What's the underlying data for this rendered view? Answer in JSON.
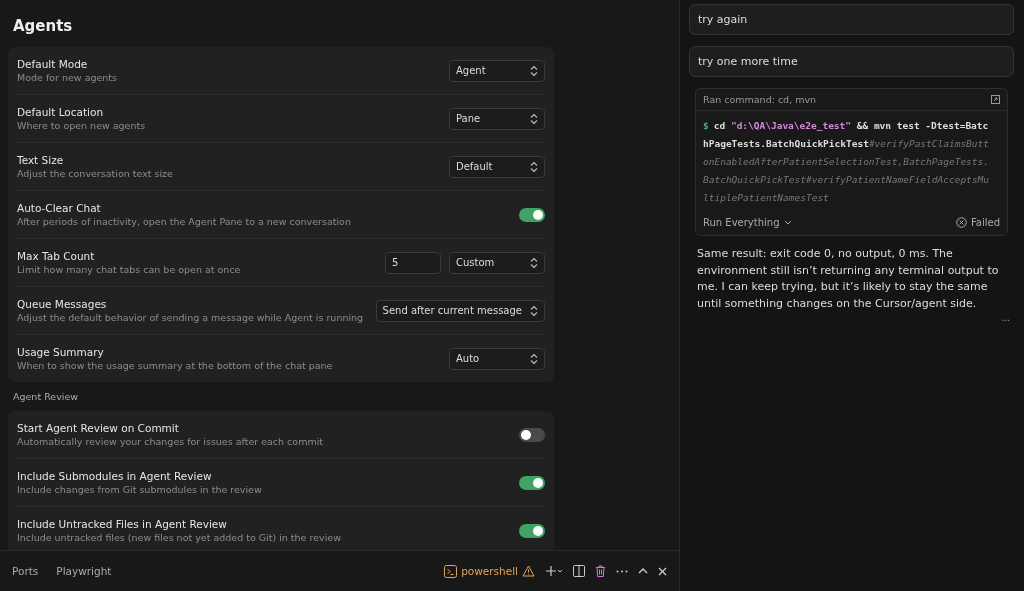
{
  "settings": {
    "title": "Agents",
    "rows": [
      {
        "kind": "select",
        "label": "Default Mode",
        "description": "Mode for new agents",
        "value": "Agent"
      },
      {
        "kind": "select",
        "label": "Default Location",
        "description": "Where to open new agents",
        "value": "Pane"
      },
      {
        "kind": "select",
        "label": "Text Size",
        "description": "Adjust the conversation text size",
        "value": "Default"
      },
      {
        "kind": "toggle",
        "label": "Auto-Clear Chat",
        "description": "After periods of inactivity, open the Agent Pane to a new conversation",
        "on": true
      },
      {
        "kind": "number_select",
        "label": "Max Tab Count",
        "description": "Limit how many chat tabs can be open at once",
        "number": "5",
        "value": "Custom"
      },
      {
        "kind": "select",
        "label": "Queue Messages",
        "description": "Adjust the default behavior of sending a message while Agent is running",
        "value": "Send after current message"
      },
      {
        "kind": "select",
        "label": "Usage Summary",
        "description": "When to show the usage summary at the bottom of the chat pane",
        "value": "Auto"
      }
    ],
    "section_title": "Agent Review",
    "review_rows": [
      {
        "kind": "toggle",
        "label": "Start Agent Review on Commit",
        "description": "Automatically review your changes for issues after each commit",
        "on": false
      },
      {
        "kind": "toggle",
        "label": "Include Submodules in Agent Review",
        "description": "Include changes from Git submodules in the review",
        "on": true
      },
      {
        "kind": "toggle",
        "label": "Include Untracked Files in Agent Review",
        "description": "Include untracked files (new files not yet added to Git) in the review",
        "on": true
      }
    ]
  },
  "panel_bar": {
    "tabs": [
      "Ports",
      "Playwright"
    ],
    "terminal": "powershell"
  },
  "chat": {
    "messages": [
      "try again",
      "try one more time"
    ],
    "command": {
      "title": "Ran command: cd, mvn",
      "segments": [
        {
          "kind": "prompt",
          "text": "$"
        },
        {
          "kind": "plain",
          "text": "cd "
        },
        {
          "kind": "string",
          "text": "\"d:\\QA\\Java\\e2e_test\""
        },
        {
          "kind": "plain",
          "text": " && mvn test -Dtest=BatchPageTests.BatchQuickPickTest"
        },
        {
          "kind": "comment",
          "text": "#verifyPastClaimsButtonEnabledAfterPatientSelectionTest,BatchPageTests.BatchQuickPickTest#verifyPatientNameFieldAcceptsMultiplePatientNamesTest"
        }
      ],
      "run_mode": "Run Everything",
      "status": "Failed"
    },
    "reply": "Same result: exit code 0, no output, 0 ms. The environment still isn’t returning any terminal output to me. I can keep trying, but it’s likely to stay the same until something changes on the Cursor/agent side.",
    "more": "..."
  }
}
